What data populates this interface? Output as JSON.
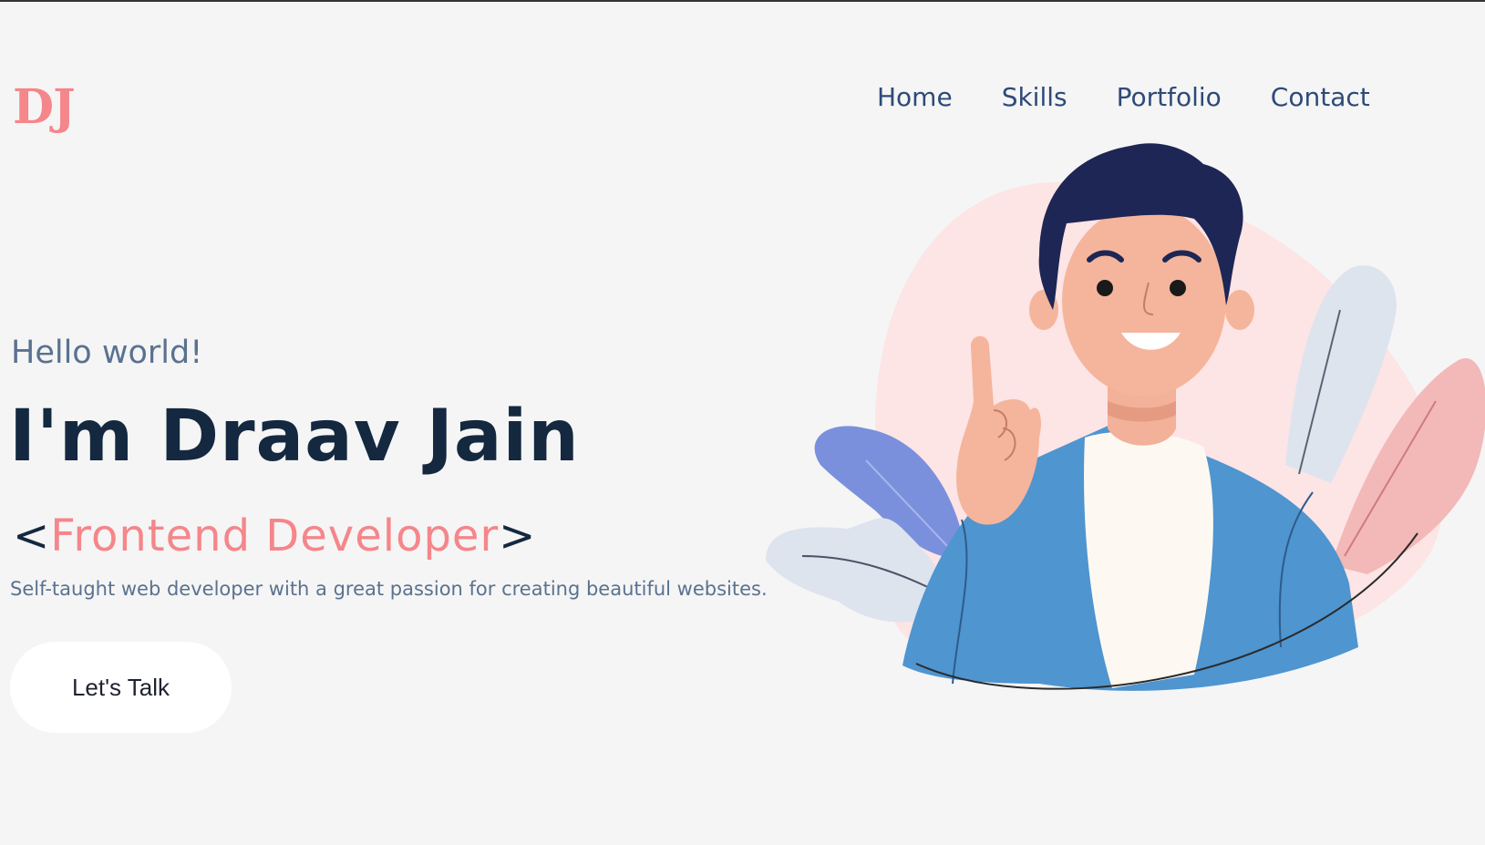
{
  "header": {
    "logo": "DJ",
    "nav": [
      {
        "label": "Home"
      },
      {
        "label": "Skills"
      },
      {
        "label": "Portfolio"
      },
      {
        "label": "Contact"
      }
    ]
  },
  "hero": {
    "greeting": "Hello world!",
    "name": "I'm Draav Jain",
    "role_open": "<",
    "role": "Frontend Developer",
    "role_close": ">",
    "tagline": "Self-taught web developer with a great passion for creating beautiful websites.",
    "cta_label": "Let's Talk"
  },
  "colors": {
    "accent": "#f5868a",
    "nav_text": "#2e4a78",
    "heading": "#142840",
    "muted": "#5a7290",
    "background": "#f5f5f5"
  }
}
